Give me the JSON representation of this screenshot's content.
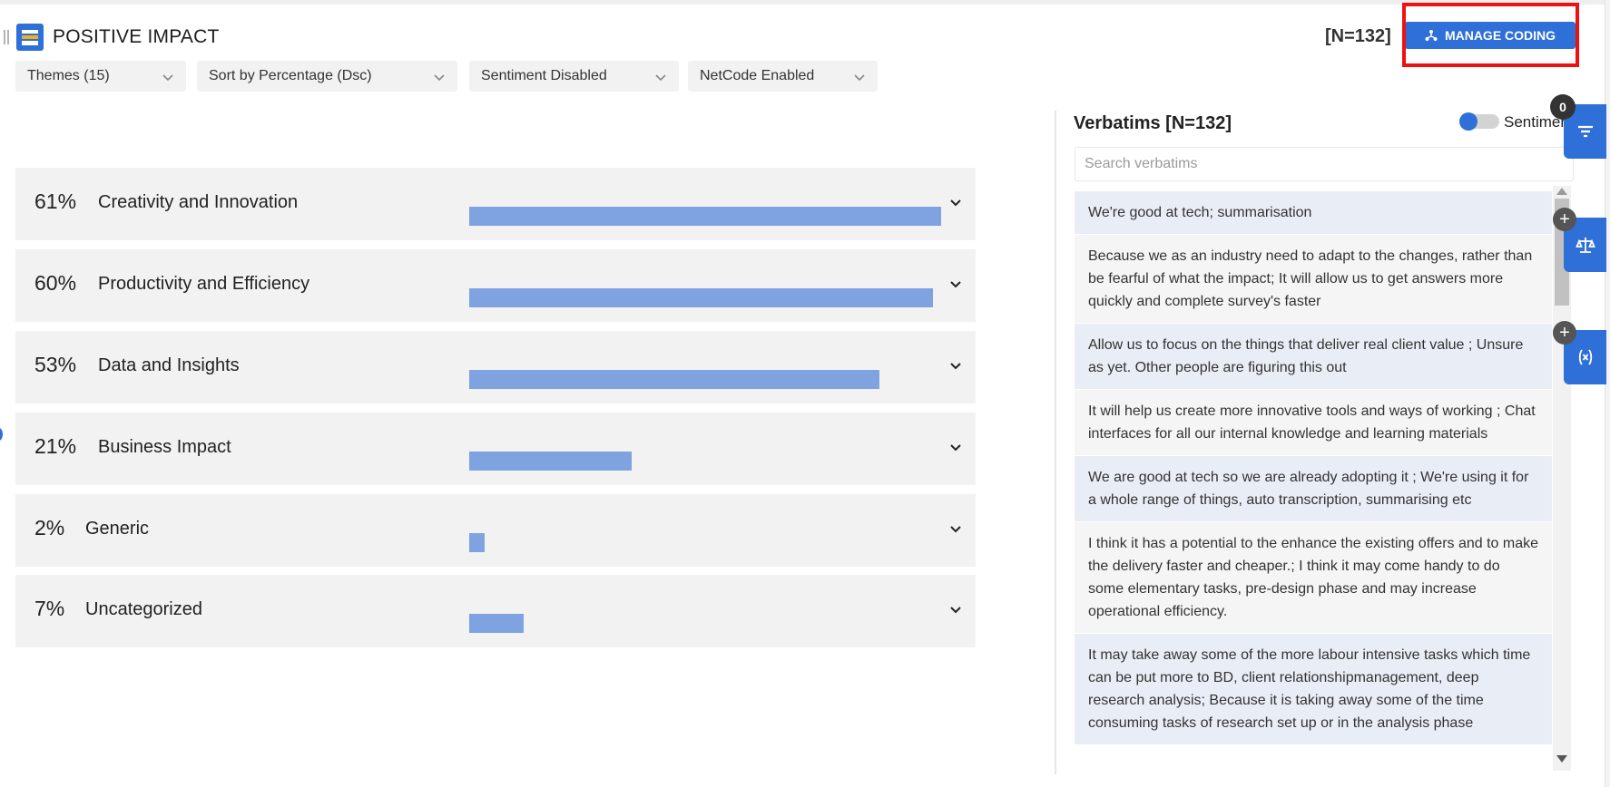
{
  "header": {
    "title": "POSITIVE IMPACT",
    "n_count": "[N=132]",
    "manage_button": "MANAGE CODING"
  },
  "filters": [
    {
      "label": "Themes (15)"
    },
    {
      "label": "Sort by Percentage (Dsc)"
    },
    {
      "label": "Sentiment Disabled"
    },
    {
      "label": "NetCode Enabled"
    }
  ],
  "themes": [
    {
      "pct": "61%",
      "label": "Creativity and Innovation",
      "value": 61
    },
    {
      "pct": "60%",
      "label": "Productivity and Efficiency",
      "value": 60
    },
    {
      "pct": "53%",
      "label": "Data and Insights",
      "value": 53
    },
    {
      "pct": "21%",
      "label": "Business Impact",
      "value": 21
    },
    {
      "pct": "2%",
      "label": "Generic",
      "value": 2
    },
    {
      "pct": "7%",
      "label": "Uncategorized",
      "value": 7
    }
  ],
  "verbatims": {
    "title": "Verbatims [N=132]",
    "toggle_label": "Sentiment",
    "toggle_on": false,
    "search_placeholder": "Search verbatims",
    "items": [
      "We're good at tech; summarisation",
      "Because we as an industry need to adapt to the changes, rather than be fearful of what the impact; It will allow us to get answers more quickly and complete survey's faster",
      "Allow us to focus on the things that deliver real client value ; Unsure as yet. Other people are figuring this out",
      "It will help us create more innovative tools and ways of working ; Chat interfaces for all our internal knowledge and learning materials",
      "We are good at tech so we are already adopting it ; We're using it for a whole range of things, auto transcription, summarising etc",
      "I think it has a potential to the enhance the existing offers and to make the delivery faster and cheaper.; I think it may come handy to do some elementary tasks, pre-design phase and may increase operational efficiency.",
      "It may take away some of the more labour intensive tasks which time can be put more to BD, client relationshipmanagement, deep research analysis; Because it is taking away some of the time consuming tasks of research set up or in the analysis phase"
    ]
  },
  "side_panel": {
    "filter_badge": "0",
    "plus_label": "+"
  },
  "colors": {
    "accent": "#2f6fd8",
    "bar": "#7fa3e0",
    "row_bg": "#f2f2f2",
    "highlight": "#ee1111"
  }
}
